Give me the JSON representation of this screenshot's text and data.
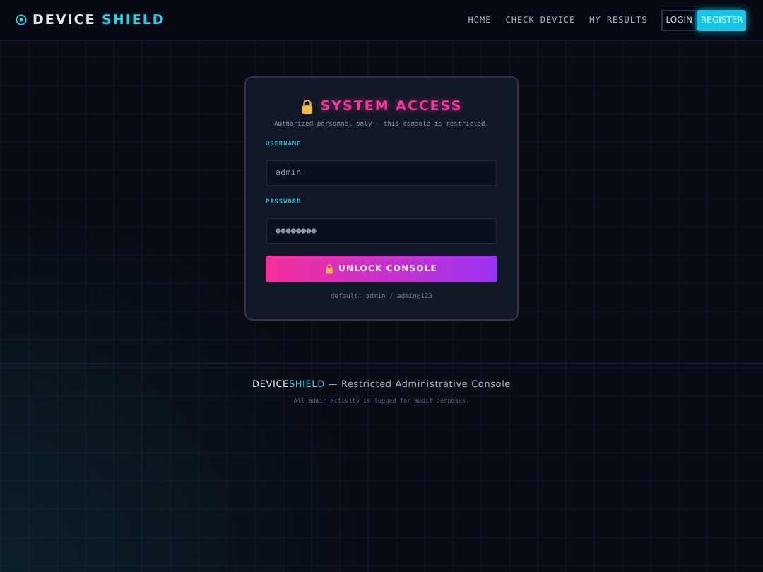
{
  "header": {
    "brand_prefix": "DEVICE",
    "brand_accent": "SHIELD",
    "nav": [
      {
        "label": "HOME",
        "kind": "link"
      },
      {
        "label": "CHECK DEVICE",
        "kind": "link"
      },
      {
        "label": "MY RESULTS",
        "kind": "link"
      },
      {
        "label": "LOGIN",
        "kind": "outline"
      },
      {
        "label": "REGISTER",
        "kind": "solid"
      }
    ]
  },
  "login": {
    "title": "SYSTEM ACCESS",
    "subtitle": "Authorized personnel only — this console is restricted.",
    "fields": [
      {
        "label": "USERNAME",
        "value": "admin"
      },
      {
        "label": "PASSWORD",
        "value": "●●●●●●●●"
      }
    ],
    "button": "UNLOCK CONSOLE",
    "hint": "default: admin / admin@123"
  },
  "footer": {
    "brand_prefix": "DEVICE",
    "brand_accent": "SHIELD",
    "tagline": "— Restricted Administrative Console",
    "note": "All admin activity is logged for audit purposes."
  }
}
